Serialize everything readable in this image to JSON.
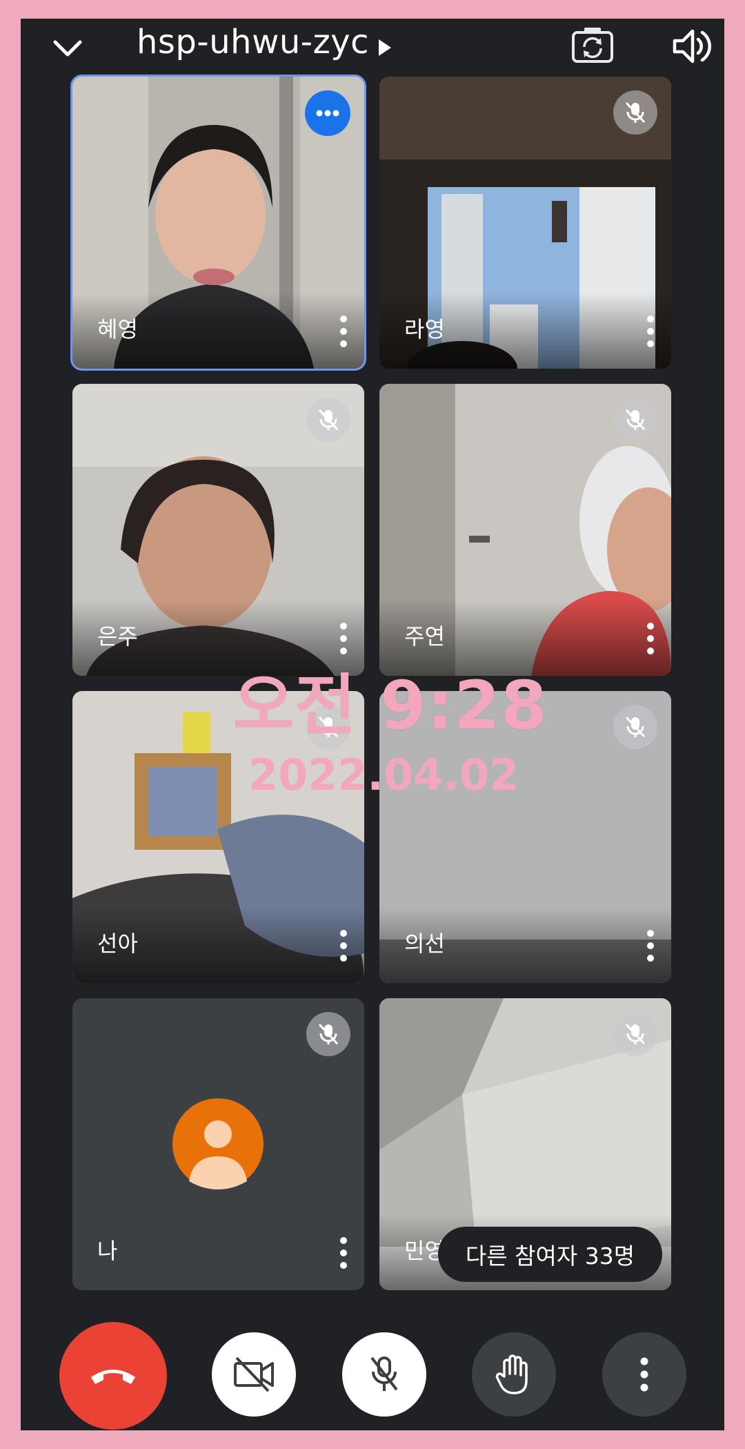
{
  "header": {
    "meeting_code": "hsp-uhwu-zyc",
    "collapse_icon": "chevron-down-icon",
    "camera_switch_icon": "camera-flip-icon",
    "audio_icon": "speaker-icon"
  },
  "participants": [
    {
      "name": "혜영",
      "muted": false,
      "active_speaker": true
    },
    {
      "name": "라영",
      "muted": true
    },
    {
      "name": "은주",
      "muted": true
    },
    {
      "name": "주연",
      "muted": true
    },
    {
      "name": "선아",
      "muted": true
    },
    {
      "name": "의선",
      "muted": true
    },
    {
      "name": "나",
      "muted": true,
      "camera_off": true
    },
    {
      "name": "민영",
      "muted": true
    }
  ],
  "overlay": {
    "time": "오전 9:28",
    "date": "2022.04.02"
  },
  "others_chip": "다른 참여자 33명",
  "controls": {
    "end_call_icon": "phone-hangup-icon",
    "camera_icon": "camera-off-icon",
    "mic_icon": "mic-off-icon",
    "raise_hand_icon": "hand-icon",
    "more_icon": "more-vert-icon"
  },
  "colors": {
    "accent_blue": "#1a73e8",
    "end_call_red": "#ea4335",
    "clock_pink": "#f2a7bd",
    "avatar_orange": "#e8710a"
  }
}
